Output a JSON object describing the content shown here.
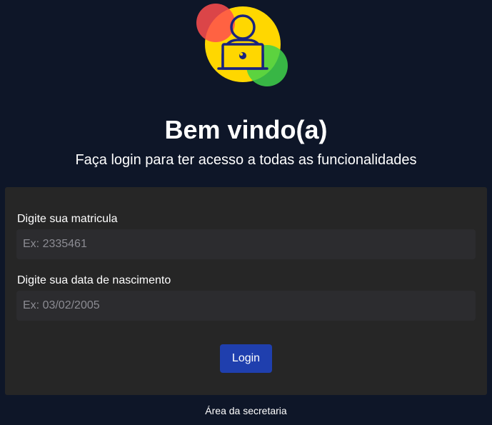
{
  "header": {
    "title": "Bem vindo(a)",
    "subtitle": "Faça login para ter acesso a todas as funcionalidades",
    "logo_icon": "user-laptop-icon"
  },
  "form": {
    "matricula_label": "Digite sua matricula",
    "matricula_placeholder": "Ex: 2335461",
    "matricula_value": "",
    "nascimento_label": "Digite sua data de nascimento",
    "nascimento_placeholder": "Ex: 03/02/2005",
    "nascimento_value": "",
    "login_label": "Login"
  },
  "footer": {
    "secretaria_link": "Área da secretaria"
  },
  "colors": {
    "background": "#0e1628",
    "card": "#262626",
    "input": "#2c2c2f",
    "button": "#1f3fae",
    "logo_yellow": "#ffd700",
    "logo_red": "#ff5f5f",
    "logo_green": "#3fd24a",
    "logo_navy": "#1a237e"
  }
}
